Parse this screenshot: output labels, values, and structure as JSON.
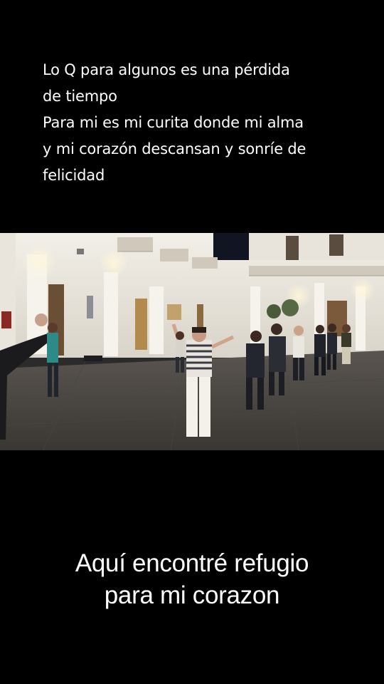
{
  "top_caption": {
    "lines": [
      "Lo Q para algunos es una pérdida",
      "de tiempo",
      "Para mi es mi curita  donde mi alma",
      "y mi corazón descansan y sonríe de",
      "felicidad"
    ]
  },
  "photo": {
    "subject": "group-dancing-in-courtyard"
  },
  "bottom_caption": {
    "lines": [
      "Aquí encontré refugio",
      "para mi corazon"
    ]
  }
}
